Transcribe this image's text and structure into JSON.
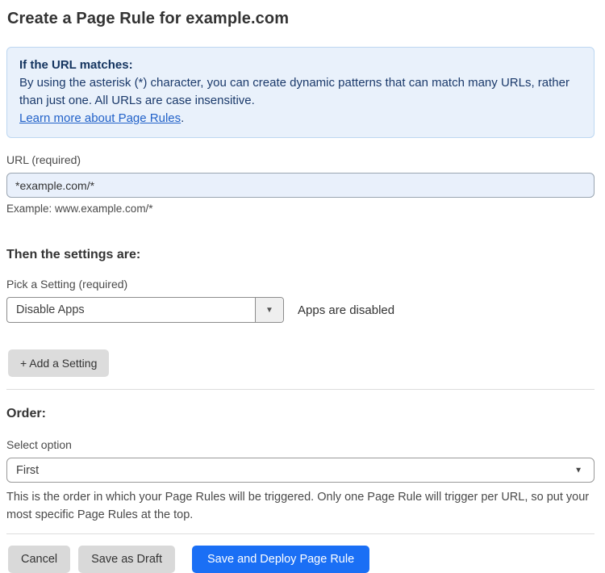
{
  "page": {
    "title": "Create a Page Rule for example.com"
  },
  "info_box": {
    "heading": "If the URL matches:",
    "body": "By using the asterisk (*) character, you can create dynamic patterns that can match many URLs, rather than just one. All URLs are case insensitive.",
    "link_label": "Learn more about Page Rules",
    "link_suffix": "."
  },
  "url_field": {
    "label": "URL (required)",
    "value": "*example.com/*",
    "helper": "Example: www.example.com/*"
  },
  "settings_section": {
    "heading": "Then the settings are:",
    "setting_label": "Pick a Setting (required)",
    "setting_value": "Disable Apps",
    "caret_icon": "▼",
    "setting_status": "Apps are disabled",
    "add_setting_label": "+ Add a Setting"
  },
  "order_section": {
    "heading": "Order:",
    "select_label": "Select option",
    "select_value": "First",
    "caret_icon": "▼",
    "helper": "This is the order in which your Page Rules will be triggered. Only one Page Rule will trigger per URL, so put your most specific Page Rules at the top."
  },
  "footer": {
    "cancel_label": "Cancel",
    "save_draft_label": "Save as Draft",
    "save_deploy_label": "Save and Deploy Page Rule"
  },
  "colors": {
    "info_box_background": "#e9f1fb",
    "info_box_border": "#bdd7f1",
    "info_text": "#1b3a6b",
    "link_blue": "#2262c9",
    "input_background": "#e9f0fb",
    "primary_button": "#1a6ff5",
    "secondary_button": "#d9d9d9"
  }
}
